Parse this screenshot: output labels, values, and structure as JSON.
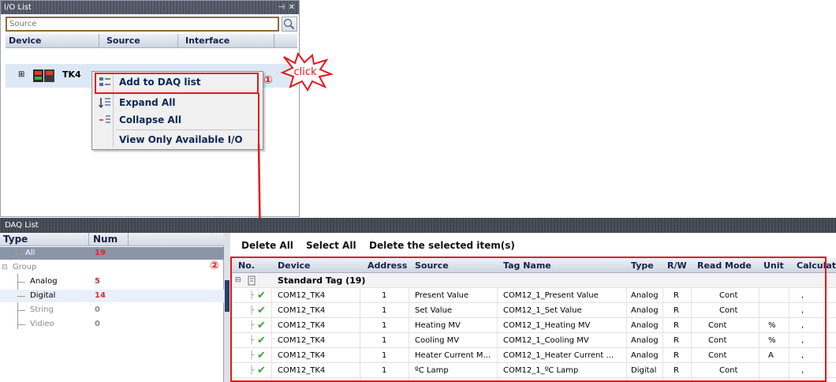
{
  "io_panel": {
    "title": "I/O List",
    "pin": "⊣",
    "close": "✕",
    "search_placeholder": "Source",
    "columns": [
      "Device",
      "Source",
      "Interface"
    ],
    "device_row": {
      "expander": "⊞",
      "name": "TK4"
    }
  },
  "context_menu": {
    "items": [
      {
        "label": "Add to DAQ list",
        "icon": "add-list-icon"
      },
      {
        "label": "Expand All",
        "icon": "expand-icon"
      },
      {
        "label": "Collapse All",
        "icon": "collapse-icon"
      },
      {
        "label": "View Only Available I/O",
        "icon": ""
      }
    ]
  },
  "annotations": {
    "step1": "①",
    "step2": "②",
    "click_burst": "click",
    "colors": {
      "annotation_red": "#e5171c"
    }
  },
  "daq": {
    "title": "DAQ List",
    "type_columns": [
      "Type",
      "Num"
    ],
    "types": [
      {
        "label": "All",
        "num": "19"
      },
      {
        "label": "Group",
        "num": ""
      },
      {
        "label": "Analog",
        "num": "5"
      },
      {
        "label": "Digital",
        "num": "14"
      },
      {
        "label": "String",
        "num": "0"
      },
      {
        "label": "Vidieo",
        "num": "0"
      }
    ],
    "toolbar": [
      "Delete All",
      "Select All",
      "Delete the selected item(s)"
    ],
    "grid_columns": [
      "No.",
      "Device",
      "Address",
      "Source",
      "Tag Name",
      "Type",
      "R/W",
      "Read Mode",
      "Unit",
      "Calculat"
    ],
    "group_row": "Standard Tag (19)",
    "rows": [
      {
        "device": "COM12_TK4",
        "address": "1",
        "source": "Present Value",
        "tag": "COM12_1_Present Value",
        "type": "Analog",
        "rw": "R",
        "mode": "Cont",
        "unit": "",
        "calc": ","
      },
      {
        "device": "COM12_TK4",
        "address": "1",
        "source": "Set Value",
        "tag": "COM12_1_Set Value",
        "type": "Analog",
        "rw": "R",
        "mode": "Cont",
        "unit": "",
        "calc": ","
      },
      {
        "device": "COM12_TK4",
        "address": "1",
        "source": "Heating MV",
        "tag": "COM12_1_Heating MV",
        "type": "Analog",
        "rw": "R",
        "mode": "Cont",
        "unit": "%",
        "calc": ","
      },
      {
        "device": "COM12_TK4",
        "address": "1",
        "source": "Cooling MV",
        "tag": "COM12_1_Cooling MV",
        "type": "Analog",
        "rw": "R",
        "mode": "Cont",
        "unit": "%",
        "calc": ","
      },
      {
        "device": "COM12_TK4",
        "address": "1",
        "source": "Heater Current M...",
        "tag": "COM12_1_Heater Current ...",
        "type": "Analog",
        "rw": "R",
        "mode": "Cont",
        "unit": "A",
        "calc": ","
      },
      {
        "device": "COM12_TK4",
        "address": "1",
        "source": "ºC Lamp",
        "tag": "COM12_1_ºC Lamp",
        "type": "Digital",
        "rw": "R",
        "mode": "Cont",
        "unit": "",
        "calc": ","
      }
    ]
  }
}
